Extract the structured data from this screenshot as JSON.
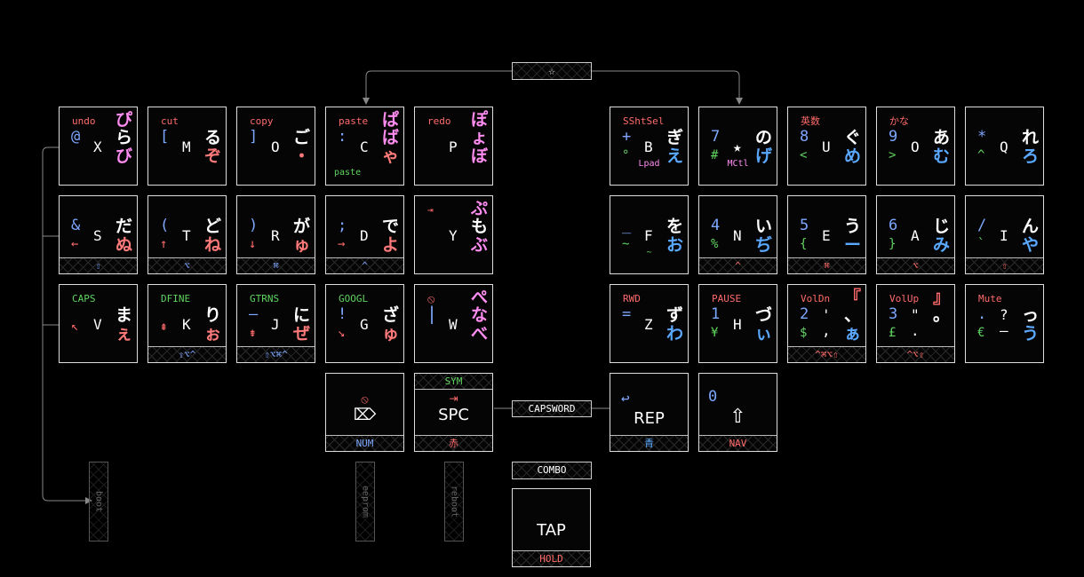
{
  "colors": {
    "red": "#ff6b6b",
    "blue": "#5aa8ff",
    "green": "#5fd45f",
    "pink": "#ff8cf0",
    "salmon": "#ff7a7a",
    "pale_blue": "#7ea7ff",
    "gray_line": "#888888"
  },
  "top_combo": {
    "label": "☆"
  },
  "capsword": {
    "label": "CAPSWORD"
  },
  "combo_label": {
    "label": "COMBO"
  },
  "legend_key": {
    "tap": "TAP",
    "hold": "HOLD"
  },
  "vertical_combos": [
    {
      "label": "boot"
    },
    {
      "label": "eeprom"
    },
    {
      "label": "reboot"
    }
  ],
  "left": {
    "r0": [
      {
        "tl": "undo",
        "l1": "@",
        "mid": "X",
        "k1": "ぴ",
        "k2": "ら",
        "k3": "び"
      },
      {
        "tl": "cut",
        "l1": "[",
        "mid": "M",
        "k1": "",
        "k2": "る",
        "k3": "ぞ"
      },
      {
        "tl": "copy",
        "l1": "]",
        "mid": "O",
        "k1": "",
        "k2": "ご",
        "k3": "・"
      },
      {
        "tl": "paste",
        "l1": ":",
        "mid": "C",
        "k1": "ぱ",
        "k2": "ば",
        "k3": "ゃ",
        "bl": "paste"
      },
      {
        "tl": "redo",
        "l1": "",
        "mid": "P",
        "k1": "ぽ",
        "k2": "ょ",
        "k3": "ぼ"
      }
    ],
    "r1": [
      {
        "l1": "&",
        "l2": "←",
        "mid": "S",
        "k2": "だ",
        "k3": "ぬ",
        "hold": "⇧"
      },
      {
        "l1": "(",
        "l2": "↑",
        "mid": "T",
        "k2": "ど",
        "k3": "ね",
        "hold": "⌥"
      },
      {
        "l1": ")",
        "l2": "↓",
        "mid": "R",
        "k2": "が",
        "k3": "ゅ",
        "hold": "⌘"
      },
      {
        "l1": ";",
        "l2": "→",
        "mid": "D",
        "k2": "で",
        "k3": "よ",
        "hold": "^"
      },
      {
        "tl": "⇥",
        "mid": "Y",
        "k1": "ぷ",
        "k2": "も",
        "k3": "ぶ"
      }
    ],
    "r2": [
      {
        "tl": "CAPS",
        "l2": "↖",
        "mid": "V",
        "k2": "ま",
        "k3": "ぇ"
      },
      {
        "tl": "DFINE",
        "l2": "⇞",
        "mid": "K",
        "k2": "り",
        "k3": "ぉ",
        "hold": "⇧⌥^"
      },
      {
        "tl": "GTRNS",
        "l1": "—",
        "l2": "⇟",
        "mid": "J",
        "k2": "に",
        "k3": "ぜ",
        "hold": "⇧⌥⌘^"
      },
      {
        "tl": "GOOGL",
        "l1": "!",
        "l2": "↘",
        "mid": "G",
        "k2": "ざ",
        "k3": "ゅ"
      },
      {
        "tl": "⦸",
        "l1": "|",
        "mid": "W",
        "k1": "ぺ",
        "k2": "な",
        "k3": "べ"
      }
    ],
    "thumbs": [
      {
        "icon": "⦸",
        "main": "⌦",
        "hold": "NUM"
      },
      {
        "top": "SYM",
        "icon": "⇥",
        "main": "SPC",
        "hold": "赤"
      }
    ]
  },
  "right": {
    "r0": [
      {
        "tl": "SShtSel",
        "l1": "+",
        "l2": "°",
        "mid": "B",
        "k2": "ぎ",
        "k3": "え",
        "bl": "Lpad"
      },
      {
        "l1": "7",
        "l2": "#",
        "mid": "★",
        "k2": "の",
        "k3": "げ",
        "bl": "MCtl"
      },
      {
        "tl": "英数",
        "l1": "8",
        "l2": "<",
        "mid": "U",
        "k2": "ぐ",
        "k3": "め"
      },
      {
        "tl": "かな",
        "l1": "9",
        "l2": ">",
        "mid": "O",
        "k2": "あ",
        "k3": "む"
      },
      {
        "l1": "*",
        "l2": "^",
        "mid": "Q",
        "k2": "れ",
        "k3": "ろ"
      }
    ],
    "r1": [
      {
        "l1": "_",
        "l2": "~",
        "mid": "F",
        "k2": "を",
        "k3": "お",
        "bl": "~"
      },
      {
        "l1": "4",
        "l2": "%",
        "mid": "N",
        "k2": "い",
        "k3": "ぢ",
        "hold": "^"
      },
      {
        "l1": "5",
        "l2": "{",
        "mid": "E",
        "k2": "う",
        "k3": "ー",
        "hold": "⌘"
      },
      {
        "l1": "6",
        "l2": "}",
        "mid": "A",
        "k2": "じ",
        "k3": "み",
        "hold": "⌥"
      },
      {
        "l1": "/",
        "l2": "`",
        "mid": "I",
        "k2": "ん",
        "k3": "や",
        "hold": "⇧"
      }
    ],
    "r2": [
      {
        "tl": "RWD",
        "l1": "=",
        "mid": "Z",
        "k2": "ず",
        "k3": "わ"
      },
      {
        "tl": "PAUSE",
        "l1": "1",
        "l2": "¥",
        "mid": "H",
        "k2": "づ",
        "k3": "ぃ"
      },
      {
        "tl": "VolDn",
        "l1": "2",
        "l2": "$",
        "mid": "'",
        "mid2": ",",
        "k1": "『",
        "k2": "、",
        "k3": "ぁ",
        "hold": "^⌘⌥⇧"
      },
      {
        "tl": "VolUp",
        "l1": "3",
        "l2": "£",
        "mid": "\"",
        "mid2": ".",
        "k1": "』",
        "k2": "。",
        "hold": "^⌥⇧"
      },
      {
        "tl": "Mute",
        "l1": ".",
        "l2": "€",
        "mid": "?",
        "mid2": "–",
        "k2": "っ",
        "k3": "う"
      }
    ],
    "thumbs": [
      {
        "icon": "↩",
        "main": "REP",
        "hold": "青"
      },
      {
        "icon": "0",
        "main": "⇧",
        "hold": "NAV"
      }
    ]
  }
}
